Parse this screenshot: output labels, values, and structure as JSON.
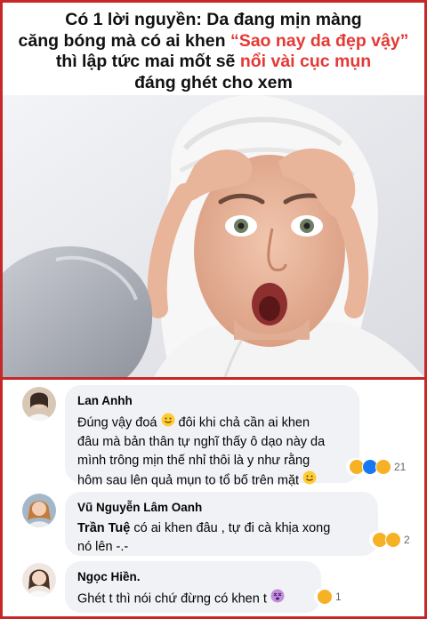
{
  "headline": {
    "line1": "Có 1 lời nguyền: Da đang mịn màng",
    "line2_a": "căng bóng mà có ai khen ",
    "line2_quote": "“Sao nay da đẹp vậy”",
    "line3_a": "thì lập tức mai mốt sẽ ",
    "line3_red": "nổi vài cục mụn",
    "line4": "đáng ghét cho xem"
  },
  "photo": {
    "subject": "woman-squeezing-pimple-in-mirror"
  },
  "colors": {
    "accent_red": "#e53935",
    "border_red": "#c62828",
    "bubble_bg": "#f0f2f5"
  },
  "comments": [
    {
      "name": "Lan Anhh",
      "text": "Đúng vậy đoá",
      "text2": " đôi khi chả cần ai khen\nđâu mà bản thân tự nghĩ thấy ô dạo này da\nmình trông mịn thế nhỉ thôi là y như rằng\nhôm sau lên quả mụn to tổ bố trên mặt",
      "reactions": [
        "haha",
        "like",
        "sad"
      ],
      "reaction_count": "21"
    },
    {
      "name": "Vũ Nguyễn Lâm Oanh",
      "tag": "Trần Tuệ",
      "text": " có ai khen đâu , tự đi cà khịa xong\nnó lên -.-",
      "reactions": [
        "haha",
        "sad"
      ],
      "reaction_count": "2"
    },
    {
      "name": "Ngọc Hiền.",
      "text": "Ghét t thì nói chứ đừng có khen t",
      "reactions": [
        "haha"
      ],
      "reaction_count": "1"
    }
  ]
}
